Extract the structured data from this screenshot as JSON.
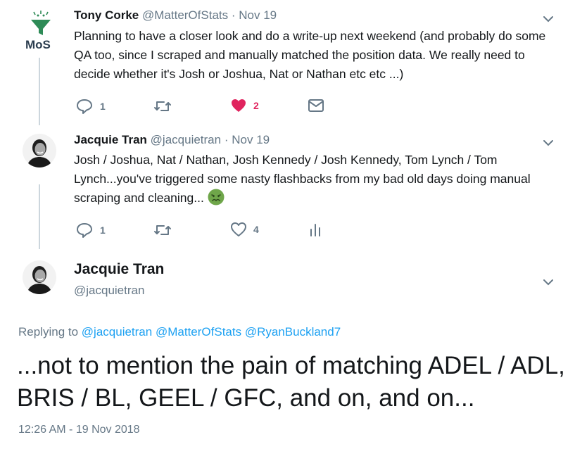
{
  "tweets": [
    {
      "name": "Tony Corke",
      "handle": "@MatterOfStats",
      "separator": "·",
      "date": "Nov 19",
      "avatar_text": "MoS",
      "text": "Planning to have a closer look and do a write-up next weekend (and probably do some QA too, since I scraped and manually matched the position data. We really need to decide whether it's Josh or Joshua, Nat or Nathan etc etc ...)",
      "reply_count": "1",
      "like_count": "2",
      "liked": true
    },
    {
      "name": "Jacquie Tran",
      "handle": "@jacquietran",
      "separator": "·",
      "date": "Nov 19",
      "text": "Josh / Joshua, Nat / Nathan, Josh Kennedy / Josh Kennedy, Tom Lynch / Tom Lynch...you've triggered some nasty flashbacks from my bad old days doing manual scraping and cleaning...",
      "reply_count": "1",
      "like_count": "4",
      "liked": false
    }
  ],
  "focused": {
    "name": "Jacquie Tran",
    "handle": "@jacquietran",
    "replying_label": "Replying to",
    "replying_to": [
      "@jacquietran",
      "@MatterOfStats",
      "@RyanBuckland7"
    ],
    "text": "...not to mention the pain of matching ADEL / ADL, BRIS / BL, GEEL / GFC, and on, and on...",
    "timestamp": "12:26 AM - 19 Nov 2018"
  },
  "colors": {
    "text": "#14171a",
    "meta": "#657786",
    "link": "#1da1f2",
    "like": "#e0245e",
    "thread": "#ccd6dd",
    "mos_green": "#2e8b57"
  },
  "icons": [
    "reply-icon",
    "retweet-icon",
    "heart-icon",
    "envelope-icon",
    "analytics-icon",
    "chevron-down-icon",
    "nauseated-face-emoji"
  ]
}
